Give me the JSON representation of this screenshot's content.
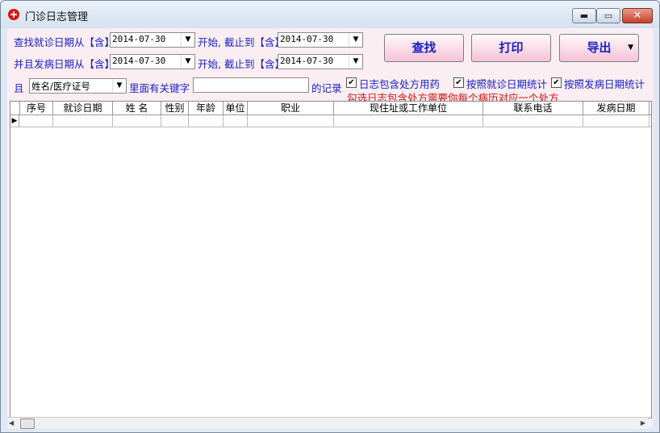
{
  "window": {
    "title": "门诊日志管理"
  },
  "filters": {
    "row1_label": "查找就诊日期从【含】",
    "row1_from": "2014-07-30",
    "row1_mid": "开始, 截止到【含】",
    "row1_to": "2014-07-30",
    "row2_label": "并且发病日期从【含】",
    "row2_from": "2014-07-30",
    "row2_mid": "开始, 截止到【含】",
    "row2_to": "2014-07-30",
    "and_label": "且",
    "field_select": "姓名/医疗证号",
    "keyword_label": "里面有关键字",
    "keyword_value": "",
    "records_suffix": "的记录"
  },
  "buttons": {
    "search": "查找",
    "print": "打印",
    "export": "导出"
  },
  "options": {
    "include_rx": "日志包含处方用药",
    "by_visit_date": "按照就诊日期统计",
    "by_onset_date": "按照发病日期统计",
    "warning": "勾选日志包含处方需要你每个病历对应一个处方"
  },
  "checks": {
    "include_rx": "✔",
    "by_visit_date": "✔",
    "by_onset_date": "✔"
  },
  "table": {
    "columns": [
      "序号",
      "就诊日期",
      "姓  名",
      "性别",
      "年龄",
      "单位",
      "职业",
      "现住址或工作单位",
      "联系电话",
      "发病日期"
    ],
    "row_indicator": "▶"
  },
  "icons": {
    "dropdown": "▼",
    "minimize": "▬",
    "maximize": "▭",
    "close": "✕",
    "scroll_left": "◀",
    "scroll_right": "▶"
  },
  "colors": {
    "label_blue": "#1a20c8",
    "warning_red": "#d41010",
    "button_pink": "#f4c2d6"
  }
}
